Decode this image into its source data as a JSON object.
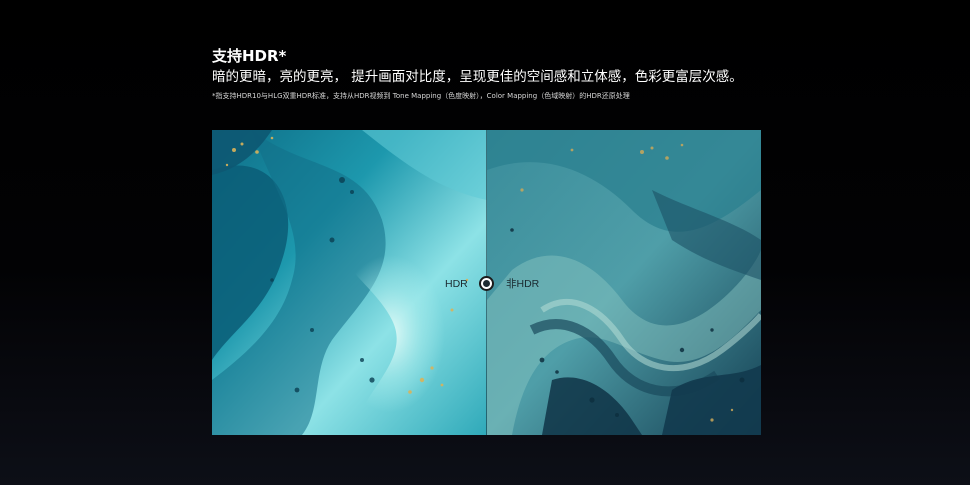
{
  "header": {
    "title": "支持HDR*",
    "subtitle": "暗的更暗，亮的更亮， 提升画面对比度，呈现更佳的空间感和立体感，色彩更富层次感。",
    "footnote": "*指支持HDR10与HLG双重HDR标准，支持从HDR视频到 Tone Mapping（色度映射），Color Mapping（色域映射）的HDR还原处理"
  },
  "compare": {
    "left_label": "HDR",
    "right_label": "非HDR",
    "slider_value": 0.5
  },
  "colors": {
    "background": "#000000",
    "hdr_teal_bright": "#7fe6ee",
    "hdr_teal_deep": "#0d6f8a",
    "non_hdr_teal": "#4f9aa6",
    "non_hdr_deep": "#0f3a4d",
    "gold": "#d7b45a"
  }
}
